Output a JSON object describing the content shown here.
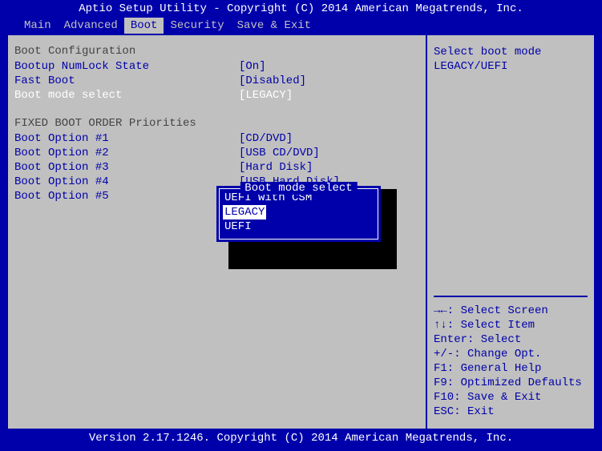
{
  "header": {
    "title": "Aptio Setup Utility - Copyright (C) 2014 American Megatrends, Inc."
  },
  "tabs": [
    {
      "label": "Main",
      "active": false
    },
    {
      "label": "Advanced",
      "active": false
    },
    {
      "label": "Boot",
      "active": true
    },
    {
      "label": "Security",
      "active": false
    },
    {
      "label": "Save & Exit",
      "active": false
    }
  ],
  "left": {
    "section1_title": "Boot Configuration",
    "rows1": [
      {
        "label": "Bootup NumLock State",
        "value": "[On]",
        "selected": false
      },
      {
        "label": "Fast Boot",
        "value": "[Disabled]",
        "selected": false
      },
      {
        "label": "Boot mode select",
        "value": "[LEGACY]",
        "selected": true
      }
    ],
    "section2_title": "FIXED BOOT ORDER Priorities",
    "rows2": [
      {
        "label": "Boot Option #1",
        "value": "[CD/DVD]"
      },
      {
        "label": "Boot Option #2",
        "value": "[USB CD/DVD]"
      },
      {
        "label": "Boot Option #3",
        "value": "[Hard Disk]"
      },
      {
        "label": "Boot Option #4",
        "value": "[USB Hard Disk]"
      },
      {
        "label": "Boot Option #5",
        "value": ""
      }
    ]
  },
  "popup": {
    "title": " Boot mode select ",
    "items": [
      {
        "label": "UEFI with CSM",
        "selected": false
      },
      {
        "label": "LEGACY",
        "selected": true
      },
      {
        "label": "UEFI",
        "selected": false
      }
    ]
  },
  "right": {
    "desc_line1": "Select boot mode",
    "desc_line2": "LEGACY/UEFI",
    "help": [
      "→←: Select Screen",
      "↑↓: Select Item",
      "Enter: Select",
      "+/-: Change Opt.",
      "F1: General Help",
      "F9: Optimized Defaults",
      "F10: Save & Exit",
      "ESC: Exit"
    ]
  },
  "footer": {
    "text": "Version 2.17.1246. Copyright (C) 2014 American Megatrends, Inc."
  }
}
